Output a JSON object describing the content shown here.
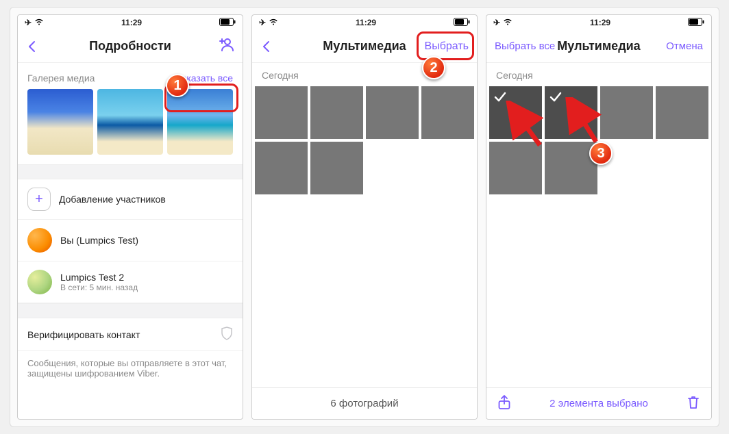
{
  "status": {
    "time": "11:29"
  },
  "accent": "#7b5bff",
  "screen1": {
    "title": "Подробности",
    "gallery_label": "Галерея медиа",
    "show_all": "Показать все",
    "add_members": "Добавление участников",
    "you_label": "Вы (Lumpics Test)",
    "member2_name": "Lumpics Test 2",
    "member2_status": "В сети: 5 мин. назад",
    "verify": "Верифицировать контакт",
    "encryption_note": "Сообщения, которые вы отправляете в этот чат, защищены шифрованием Viber.",
    "badge": "1"
  },
  "screen2": {
    "title": "Мультимедиа",
    "select": "Выбрать",
    "today": "Сегодня",
    "footer": "6 фотографий",
    "badge": "2"
  },
  "screen3": {
    "select_all": "Выбрать все",
    "title": "Мультимедиа",
    "cancel": "Отмена",
    "today": "Сегодня",
    "footer_status": "2 элемента выбрано",
    "badge": "3"
  }
}
